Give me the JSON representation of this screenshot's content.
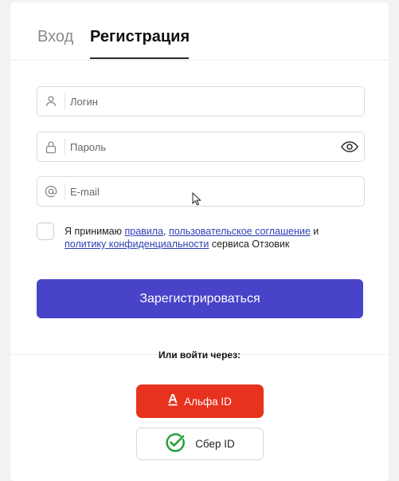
{
  "tabs": {
    "login_label": "Вход",
    "register_label": "Регистрация"
  },
  "form": {
    "login_placeholder": "Логин",
    "password_placeholder": "Пароль",
    "email_placeholder": "E-mail",
    "agree": {
      "prefix": "Я принимаю ",
      "rules_link": "правила",
      "comma": ", ",
      "user_agreement_link": "пользовательское соглашение",
      "and": " и ",
      "privacy_link": "политику конфиденциальности",
      "suffix": " сервиса Отзовик"
    },
    "submit_label": "Зарегистрироваться"
  },
  "social": {
    "or_label": "Или войти через:",
    "alfa_label": "Альфа ID",
    "sber_label": "Сбер ID"
  },
  "colors": {
    "accent": "#4843c8",
    "alfa": "#e7321e",
    "sber": "#21a038"
  },
  "icons": [
    "user-icon",
    "lock-icon",
    "at-icon",
    "eye-icon",
    "alfa-logo-icon",
    "sber-check-icon",
    "mouse-cursor-icon"
  ]
}
